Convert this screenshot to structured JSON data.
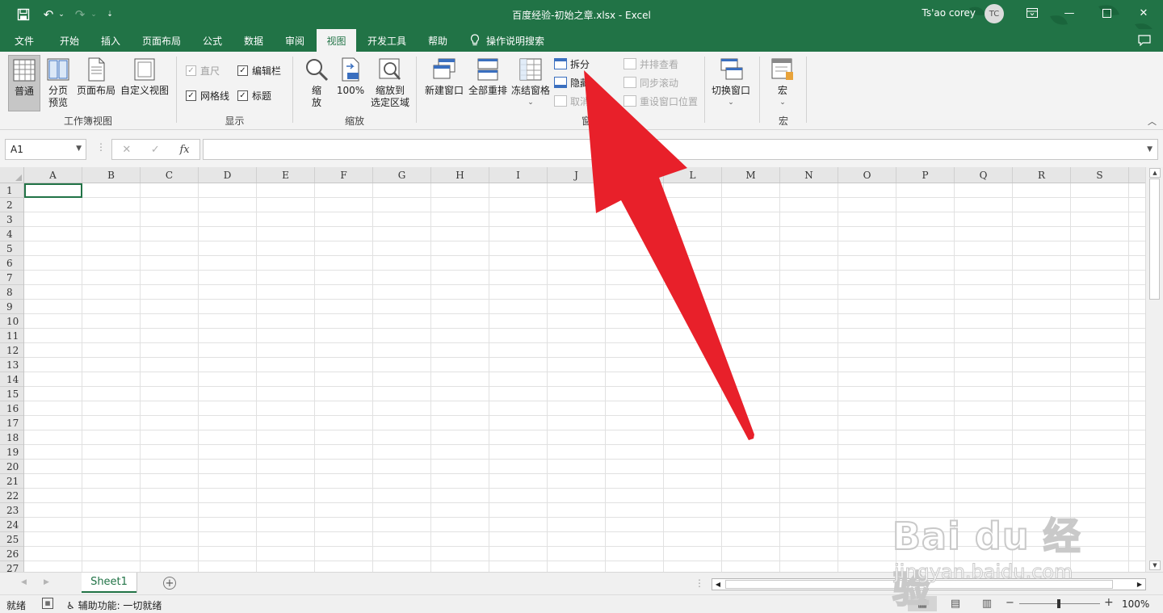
{
  "window": {
    "title": "百度经验-初始之章.xlsx  -  Excel",
    "user": "Ts'ao corey",
    "avatar_initials": "TC",
    "accent": "#217346"
  },
  "tabs": [
    "文件",
    "开始",
    "插入",
    "页面布局",
    "公式",
    "数据",
    "审阅",
    "视图",
    "开发工具",
    "帮助"
  ],
  "active_tab": "视图",
  "tell_me": "操作说明搜索",
  "ribbon": {
    "workbook_views": {
      "label": "工作簿视图",
      "normal": "普通",
      "page_break_l1": "分页",
      "page_break_l2": "预览",
      "page_layout": "页面布局",
      "custom": "自定义视图"
    },
    "show": {
      "label": "显示",
      "ruler": "直尺",
      "formula_bar": "编辑栏",
      "gridlines": "网格线",
      "headings": "标题",
      "checks": {
        "ruler": true,
        "formula_bar": true,
        "gridlines": true,
        "headings": true
      }
    },
    "zoom": {
      "label": "缩放",
      "zoom_l1": "缩",
      "zoom_l2": "放",
      "hundred": "100%",
      "to_sel_l1": "缩放到",
      "to_sel_l2": "选定区域"
    },
    "window": {
      "label": "窗",
      "new_window": "新建窗口",
      "arrange_all": "全部重排",
      "freeze": "冻结窗格",
      "split": "拆分",
      "hide": "隐藏",
      "unhide": "取消",
      "side_by_side": "并排查看",
      "sync_scroll": "同步滚动",
      "reset_pos": "重设窗口位置",
      "switch": "切换窗口"
    },
    "macros": {
      "label": "宏",
      "macros": "宏"
    }
  },
  "formula_bar": {
    "name_box": "A1",
    "cancel": "✕",
    "enter": "✓",
    "fx": "fx",
    "value": ""
  },
  "columns": [
    "A",
    "B",
    "C",
    "D",
    "E",
    "F",
    "G",
    "H",
    "I",
    "J",
    "K",
    "L",
    "M",
    "N",
    "O",
    "P",
    "Q",
    "R",
    "S"
  ],
  "rows": [
    "1",
    "2",
    "3",
    "4",
    "5",
    "6",
    "7",
    "8",
    "9",
    "10",
    "11",
    "12",
    "13",
    "14",
    "15",
    "16",
    "17",
    "18",
    "19",
    "20",
    "21",
    "22",
    "23",
    "24",
    "25",
    "26",
    "27"
  ],
  "sheets": [
    "Sheet1"
  ],
  "status": {
    "ready": "就绪",
    "accessibility": "辅助功能: 一切就绪",
    "zoom": "100%"
  },
  "annotation": {
    "color": "#e8202a"
  },
  "watermark": {
    "brand": "Bai du 经验",
    "url": "jingyan.baidu.com"
  }
}
